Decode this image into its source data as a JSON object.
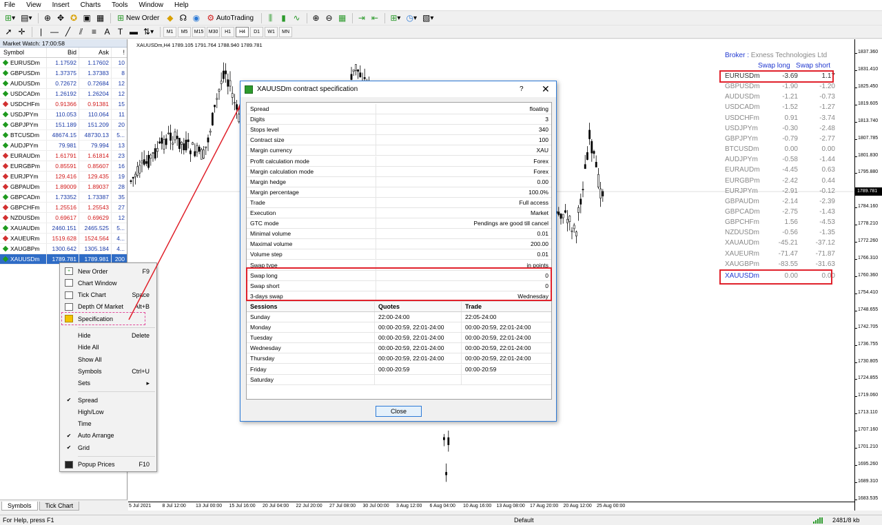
{
  "menu": [
    "File",
    "View",
    "Insert",
    "Charts",
    "Tools",
    "Window",
    "Help"
  ],
  "toolbar": {
    "new_order": "New Order",
    "autotrading": "AutoTrading"
  },
  "timeframes": [
    "M1",
    "M5",
    "M15",
    "M30",
    "H1",
    "H4",
    "D1",
    "W1",
    "MN"
  ],
  "active_timeframe": "H4",
  "market_watch": {
    "title": "Market Watch: 17:00:58",
    "headers": {
      "symbol": "Symbol",
      "bid": "Bid",
      "ask": "Ask",
      "spread": "!"
    },
    "rows": [
      {
        "symbol": "EURUSDm",
        "bid": "1.17592",
        "ask": "1.17602",
        "spread": "10",
        "dir": "up"
      },
      {
        "symbol": "GBPUSDm",
        "bid": "1.37375",
        "ask": "1.37383",
        "spread": "8",
        "dir": "up"
      },
      {
        "symbol": "AUDUSDm",
        "bid": "0.72672",
        "ask": "0.72684",
        "spread": "12",
        "dir": "up"
      },
      {
        "symbol": "USDCADm",
        "bid": "1.26192",
        "ask": "1.26204",
        "spread": "12",
        "dir": "up"
      },
      {
        "symbol": "USDCHFm",
        "bid": "0.91366",
        "ask": "0.91381",
        "spread": "15",
        "dir": "dn"
      },
      {
        "symbol": "USDJPYm",
        "bid": "110.053",
        "ask": "110.064",
        "spread": "11",
        "dir": "up"
      },
      {
        "symbol": "GBPJPYm",
        "bid": "151.189",
        "ask": "151.209",
        "spread": "20",
        "dir": "up"
      },
      {
        "symbol": "BTCUSDm",
        "bid": "48674.15",
        "ask": "48730.13",
        "spread": "5...",
        "dir": "up"
      },
      {
        "symbol": "AUDJPYm",
        "bid": "79.981",
        "ask": "79.994",
        "spread": "13",
        "dir": "up"
      },
      {
        "symbol": "EURAUDm",
        "bid": "1.61791",
        "ask": "1.61814",
        "spread": "23",
        "dir": "dn"
      },
      {
        "symbol": "EURGBPm",
        "bid": "0.85591",
        "ask": "0.85607",
        "spread": "16",
        "dir": "dn"
      },
      {
        "symbol": "EURJPYm",
        "bid": "129.416",
        "ask": "129.435",
        "spread": "19",
        "dir": "dn"
      },
      {
        "symbol": "GBPAUDm",
        "bid": "1.89009",
        "ask": "1.89037",
        "spread": "28",
        "dir": "dn"
      },
      {
        "symbol": "GBPCADm",
        "bid": "1.73352",
        "ask": "1.73387",
        "spread": "35",
        "dir": "up"
      },
      {
        "symbol": "GBPCHFm",
        "bid": "1.25516",
        "ask": "1.25543",
        "spread": "27",
        "dir": "dn"
      },
      {
        "symbol": "NZDUSDm",
        "bid": "0.69617",
        "ask": "0.69629",
        "spread": "12",
        "dir": "dn"
      },
      {
        "symbol": "XAUAUDm",
        "bid": "2460.151",
        "ask": "2465.525",
        "spread": "5...",
        "dir": "up"
      },
      {
        "symbol": "XAUEURm",
        "bid": "1519.628",
        "ask": "1524.564",
        "spread": "4...",
        "dir": "dn"
      },
      {
        "symbol": "XAUGBPm",
        "bid": "1300.642",
        "ask": "1305.184",
        "spread": "4...",
        "dir": "up"
      },
      {
        "symbol": "XAUUSDm",
        "bid": "1789.781",
        "ask": "1789.981",
        "spread": "200",
        "dir": "sel"
      }
    ],
    "tabs": [
      "Symbols",
      "Tick Chart"
    ]
  },
  "context_menu": [
    {
      "label": "New Order",
      "shortcut": "F9",
      "icon": "new-order"
    },
    {
      "label": "Chart Window",
      "shortcut": "",
      "icon": "chart-window"
    },
    {
      "label": "Tick Chart",
      "shortcut": "Space",
      "icon": "tick-chart"
    },
    {
      "label": "Depth Of Market",
      "shortcut": "Alt+B",
      "icon": "depth"
    },
    {
      "label": "Specification",
      "shortcut": "",
      "icon": "spec"
    },
    {
      "sep": true
    },
    {
      "label": "Hide",
      "shortcut": "Delete"
    },
    {
      "label": "Hide All",
      "shortcut": ""
    },
    {
      "label": "Show All",
      "shortcut": ""
    },
    {
      "label": "Symbols",
      "shortcut": "Ctrl+U"
    },
    {
      "label": "Sets",
      "shortcut": "▸"
    },
    {
      "sep": true
    },
    {
      "label": "Spread",
      "shortcut": "",
      "check": true
    },
    {
      "label": "High/Low",
      "shortcut": ""
    },
    {
      "label": "Time",
      "shortcut": ""
    },
    {
      "label": "Auto Arrange",
      "shortcut": "",
      "check": true
    },
    {
      "label": "Grid",
      "shortcut": "",
      "check": true
    },
    {
      "sep": true
    },
    {
      "label": "Popup Prices",
      "shortcut": "F10",
      "icon": "popup"
    }
  ],
  "chart": {
    "label": "XAUUSDm,H4  1789.105 1791.764 1788.940 1789.781",
    "current_price": "1789.781",
    "prices": [
      "1837.360",
      "1831.410",
      "1825.450",
      "1819.605",
      "1813.740",
      "1807.785",
      "1801.830",
      "1795.880",
      "1789.781",
      "1784.160",
      "1778.210",
      "1772.260",
      "1766.310",
      "1760.360",
      "1754.410",
      "1748.655",
      "1742.705",
      "1736.755",
      "1730.805",
      "1724.855",
      "1719.060",
      "1713.110",
      "1707.160",
      "1701.210",
      "1695.260",
      "1689.310",
      "1683.535"
    ],
    "times": [
      "5 Jul 2021",
      "8 Jul 12:00",
      "13 Jul 00:00",
      "15 Jul 16:00",
      "20 Jul 04:00",
      "22 Jul 20:00",
      "27 Jul 08:00",
      "30 Jul 00:00",
      "3 Aug 12:00",
      "6 Aug 04:00",
      "10 Aug 16:00",
      "13 Aug 08:00",
      "17 Aug 20:00",
      "20 Aug 12:00",
      "25 Aug 00:00"
    ]
  },
  "broker": {
    "prefix": "Broker : ",
    "name": "Exness Technologies Ltd",
    "swap_long_header": "Swap long",
    "swap_short_header": "Swap short"
  },
  "swaps": [
    {
      "symbol": "EURUSDm",
      "long": "-3.69",
      "short": "1.17"
    },
    {
      "symbol": "GBPUSDm",
      "long": "-1.90",
      "short": "-1.20"
    },
    {
      "symbol": "AUDUSDm",
      "long": "-1.21",
      "short": "-0.73"
    },
    {
      "symbol": "USDCADm",
      "long": "-1.52",
      "short": "-1.27"
    },
    {
      "symbol": "USDCHFm",
      "long": "0.91",
      "short": "-3.74"
    },
    {
      "symbol": "USDJPYm",
      "long": "-0.30",
      "short": "-2.48"
    },
    {
      "symbol": "GBPJPYm",
      "long": "-0.79",
      "short": "-2.77"
    },
    {
      "symbol": "BTCUSDm",
      "long": "0.00",
      "short": "0.00"
    },
    {
      "symbol": "AUDJPYm",
      "long": "-0.58",
      "short": "-1.44"
    },
    {
      "symbol": "EURAUDm",
      "long": "-4.45",
      "short": "0.63"
    },
    {
      "symbol": "EURGBPm",
      "long": "-2.42",
      "short": "0.44"
    },
    {
      "symbol": "EURJPYm",
      "long": "-2.91",
      "short": "-0.12"
    },
    {
      "symbol": "GBPAUDm",
      "long": "-2.14",
      "short": "-2.39"
    },
    {
      "symbol": "GBPCADm",
      "long": "-2.75",
      "short": "-1.43"
    },
    {
      "symbol": "GBPCHFm",
      "long": "1.56",
      "short": "-4.53"
    },
    {
      "symbol": "NZDUSDm",
      "long": "-0.56",
      "short": "-1.35"
    },
    {
      "symbol": "XAUAUDm",
      "long": "-45.21",
      "short": "-37.12"
    },
    {
      "symbol": "XAUEURm",
      "long": "-71.47",
      "short": "-71.87"
    },
    {
      "symbol": "XAUGBPm",
      "long": "-83.55",
      "short": "-31.63"
    },
    {
      "symbol": "XAUUSDm",
      "long": "0.00",
      "short": "0.00"
    }
  ],
  "dialog": {
    "title": "XAUUSDm contract specification",
    "help": "?",
    "close_x": "✕",
    "spec": [
      [
        "Spread",
        "floating"
      ],
      [
        "Digits",
        "3"
      ],
      [
        "Stops level",
        "340"
      ],
      [
        "Contract size",
        "100"
      ],
      [
        "Margin currency",
        "XAU"
      ],
      [
        "Profit calculation mode",
        "Forex"
      ],
      [
        "Margin calculation mode",
        "Forex"
      ],
      [
        "Margin hedge",
        "0.00"
      ],
      [
        "Margin percentage",
        "100.0%"
      ],
      [
        "Trade",
        "Full access"
      ],
      [
        "Execution",
        "Market"
      ],
      [
        "GTC mode",
        "Pendings are good till cancel"
      ],
      [
        "Minimal volume",
        "0.01"
      ],
      [
        "Maximal volume",
        "200.00"
      ],
      [
        "Volume step",
        "0.01"
      ],
      [
        "Swap type",
        "in points"
      ],
      [
        "Swap long",
        "0"
      ],
      [
        "Swap short",
        "0"
      ],
      [
        "3-days swap",
        "Wednesday"
      ]
    ],
    "sessions_header": {
      "day": "Sessions",
      "quotes": "Quotes",
      "trade": "Trade"
    },
    "sessions": [
      [
        "Sunday",
        "22:00-24:00",
        "22:05-24:00"
      ],
      [
        "Monday",
        "00:00-20:59, 22:01-24:00",
        "00:00-20:59, 22:01-24:00"
      ],
      [
        "Tuesday",
        "00:00-20:59, 22:01-24:00",
        "00:00-20:59, 22:01-24:00"
      ],
      [
        "Wednesday",
        "00:00-20:59, 22:01-24:00",
        "00:00-20:59, 22:01-24:00"
      ],
      [
        "Thursday",
        "00:00-20:59, 22:01-24:00",
        "00:00-20:59, 22:01-24:00"
      ],
      [
        "Friday",
        "00:00-20:59",
        "00:00-20:59"
      ],
      [
        "Saturday",
        "",
        ""
      ]
    ],
    "close_label": "Close"
  },
  "status": {
    "help": "For Help, press F1",
    "profile": "Default",
    "traffic": "2481/8 kb"
  },
  "colors": {
    "highlight": "#e0202a",
    "selection": "#2f6cc6",
    "up": "#1a3aa8",
    "down": "#d21a1a"
  }
}
